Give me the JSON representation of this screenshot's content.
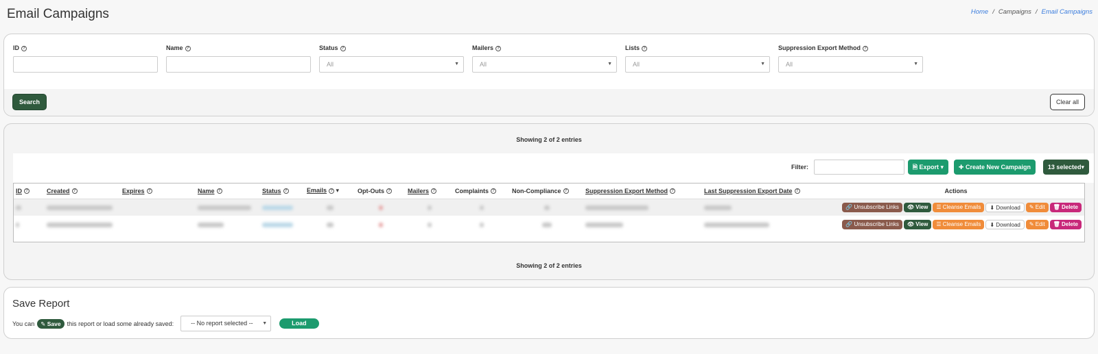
{
  "page": {
    "title": "Email Campaigns"
  },
  "breadcrumb": {
    "home": "Home",
    "sep": "/",
    "campaigns": "Campaigns",
    "current": "Email Campaigns"
  },
  "filters": {
    "id_label": "ID",
    "name_label": "Name",
    "status_label": "Status",
    "mailers_label": "Mailers",
    "lists_label": "Lists",
    "suppression_label": "Suppression Export Method",
    "all_value": "All",
    "search_button": "Search",
    "clear_button": "Clear all"
  },
  "table": {
    "showing": "Showing 2 of 2 entries",
    "filter_label": "Filter:",
    "export_button": "Export",
    "create_button": "Create New Campaign",
    "selected_button": "13 selected",
    "columns": [
      "ID",
      "Created",
      "Expires",
      "Name",
      "Status",
      "Emails",
      "Opt-Outs",
      "Mailers",
      "Complaints",
      "Non-Compliance",
      "Suppression Export Method",
      "Last Suppression Export Date",
      "Actions"
    ],
    "actions": {
      "unsubscribe": "Unsubscribe Links",
      "view": "View",
      "cleanse": "Cleanse Emails",
      "download": "Download",
      "edit": "Edit",
      "delete": "Delete"
    }
  },
  "save_report": {
    "title": "Save Report",
    "prefix": "You can",
    "save_label": "Save",
    "suffix": "this report or load some already saved:",
    "select_value": "-- No report selected --",
    "load_button": "Load"
  },
  "icons": [
    "help-circle-icon",
    "caret-down-icon",
    "file-export-icon",
    "plus-icon",
    "link-icon",
    "eye-icon",
    "list-icon",
    "download-icon",
    "edit-icon",
    "trash-icon"
  ]
}
